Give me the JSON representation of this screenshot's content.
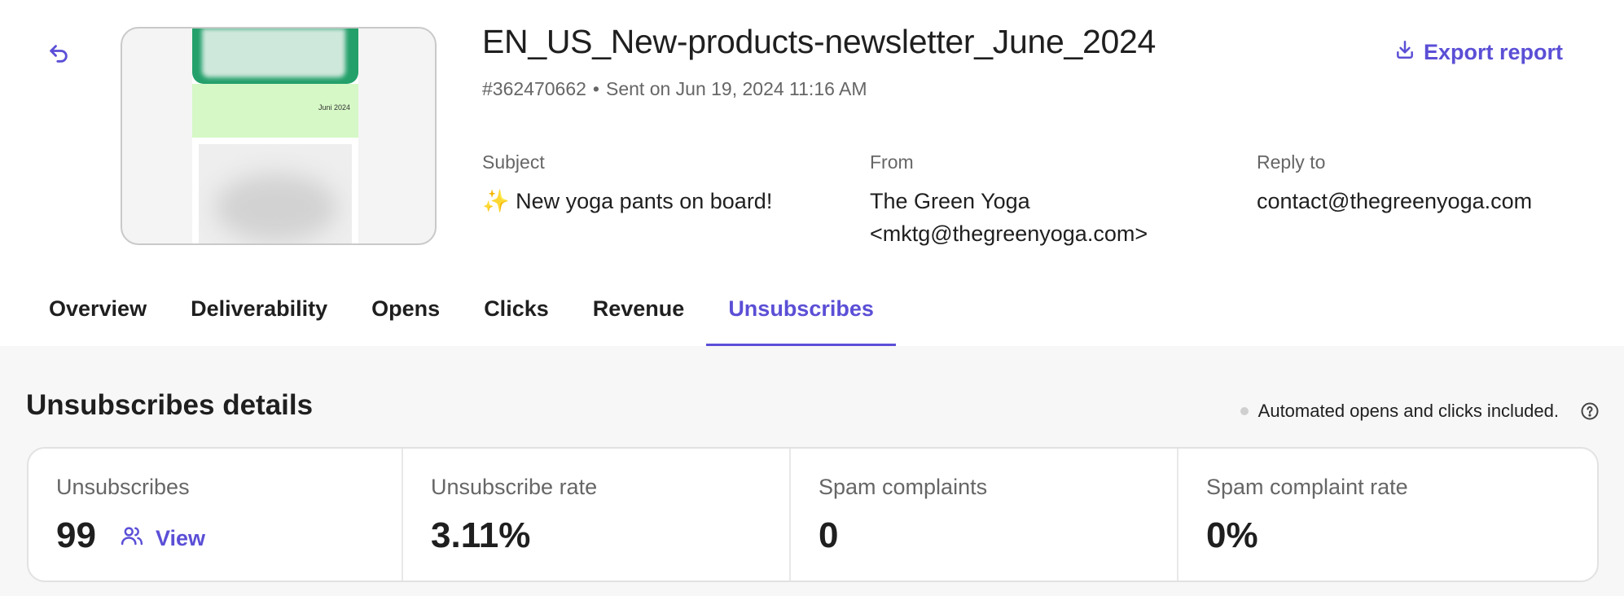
{
  "header": {
    "back_icon": "undo-arrow-icon",
    "title": "EN_US_New-products-newsletter_June_2024",
    "campaign_id": "#362470662",
    "sent_text": "Sent on Jun 19, 2024 11:16 AM",
    "export_label": "Export report",
    "export_icon": "download-icon",
    "thumbnail_date": "Juni 2024",
    "accent_color": "#5b4fd6"
  },
  "fields": {
    "subject_label": "Subject",
    "subject_value": "✨ New yoga pants on board!",
    "from_label": "From",
    "from_name": "The Green Yoga",
    "from_email": "<mktg@thegreenyoga.com>",
    "reply_label": "Reply to",
    "reply_value": "contact@thegreenyoga.com"
  },
  "tabs": [
    {
      "label": "Overview",
      "active": false
    },
    {
      "label": "Deliverability",
      "active": false
    },
    {
      "label": "Opens",
      "active": false
    },
    {
      "label": "Clicks",
      "active": false
    },
    {
      "label": "Revenue",
      "active": false
    },
    {
      "label": "Unsubscribes",
      "active": true
    }
  ],
  "section": {
    "title": "Unsubscribes details",
    "note": "Automated opens and clicks included.",
    "help_icon": "question-circle-icon"
  },
  "stats": [
    {
      "label": "Unsubscribes",
      "value": "99",
      "link": "View",
      "link_icon": "users-icon"
    },
    {
      "label": "Unsubscribe rate",
      "value": "3.11%"
    },
    {
      "label": "Spam complaints",
      "value": "0"
    },
    {
      "label": "Spam complaint rate",
      "value": "0%"
    }
  ]
}
